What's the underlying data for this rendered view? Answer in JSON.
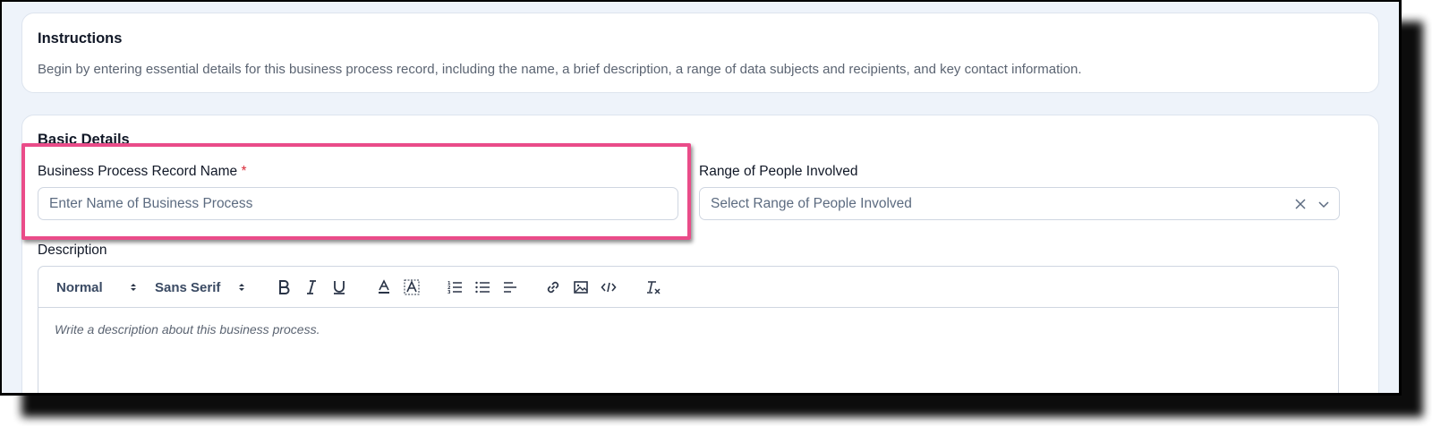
{
  "instructions": {
    "title": "Instructions",
    "text": "Begin by entering essential details for this business process record, including the name, a brief description, a range of data subjects and recipients, and key contact information."
  },
  "basic_details": {
    "title": "Basic Details",
    "record_name": {
      "label": "Business Process Record Name",
      "required_mark": "*",
      "placeholder": "Enter Name of Business Process",
      "value": ""
    },
    "range_people": {
      "label": "Range of People Involved",
      "placeholder": "Select Range of People Involved",
      "clear_icon": "close-icon",
      "dropdown_icon": "chevron-down-icon"
    },
    "description": {
      "label": "Description",
      "placeholder": "Write a description about this business process.",
      "toolbar": {
        "header_picker": "Normal",
        "font_picker": "Sans Serif",
        "buttons": [
          "bold-icon",
          "italic-icon",
          "underline-icon",
          "text-color-icon",
          "background-color-icon",
          "ordered-list-icon",
          "bullet-list-icon",
          "align-icon",
          "link-icon",
          "image-icon",
          "code-icon",
          "clear-format-icon"
        ]
      }
    }
  },
  "colors": {
    "highlight": "#ea4c89",
    "required": "#d92d3a",
    "page_bg": "#eef3fa"
  }
}
